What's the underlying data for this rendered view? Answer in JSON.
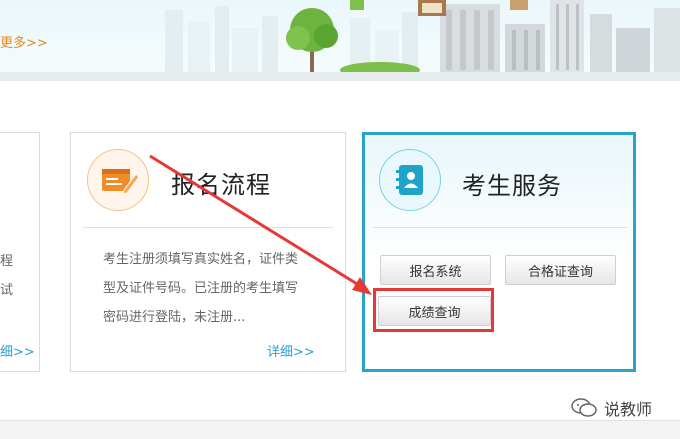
{
  "banner": {
    "more_link": "更多>>"
  },
  "cards": {
    "left": {
      "text_lines": [
        "程",
        "试"
      ],
      "detail_link": "细>>"
    },
    "registration": {
      "title": "报名流程",
      "icon": "form-pen-icon",
      "description": "考生注册须填写真实姓名，证件类型及证件号码。已注册的考生填写密码进行登陆，未注册...",
      "description_lines": [
        "考生注册须填写真实姓名，证件类",
        "型及证件号码。已注册的考生填写",
        "密码进行登陆，未注册..."
      ],
      "detail_link": "详细>>"
    },
    "service": {
      "title": "考生服务",
      "icon": "contact-book-icon",
      "buttons": [
        "报名系统",
        "合格证查询",
        "成绩查询"
      ]
    }
  },
  "watermark": {
    "label": "说教师",
    "icon": "wechat-icon"
  },
  "colors": {
    "accent_orange": "#e58a1f",
    "accent_blue": "#2aa3c9",
    "highlight_red": "#e53935",
    "link_blue": "#2a9fd6"
  }
}
